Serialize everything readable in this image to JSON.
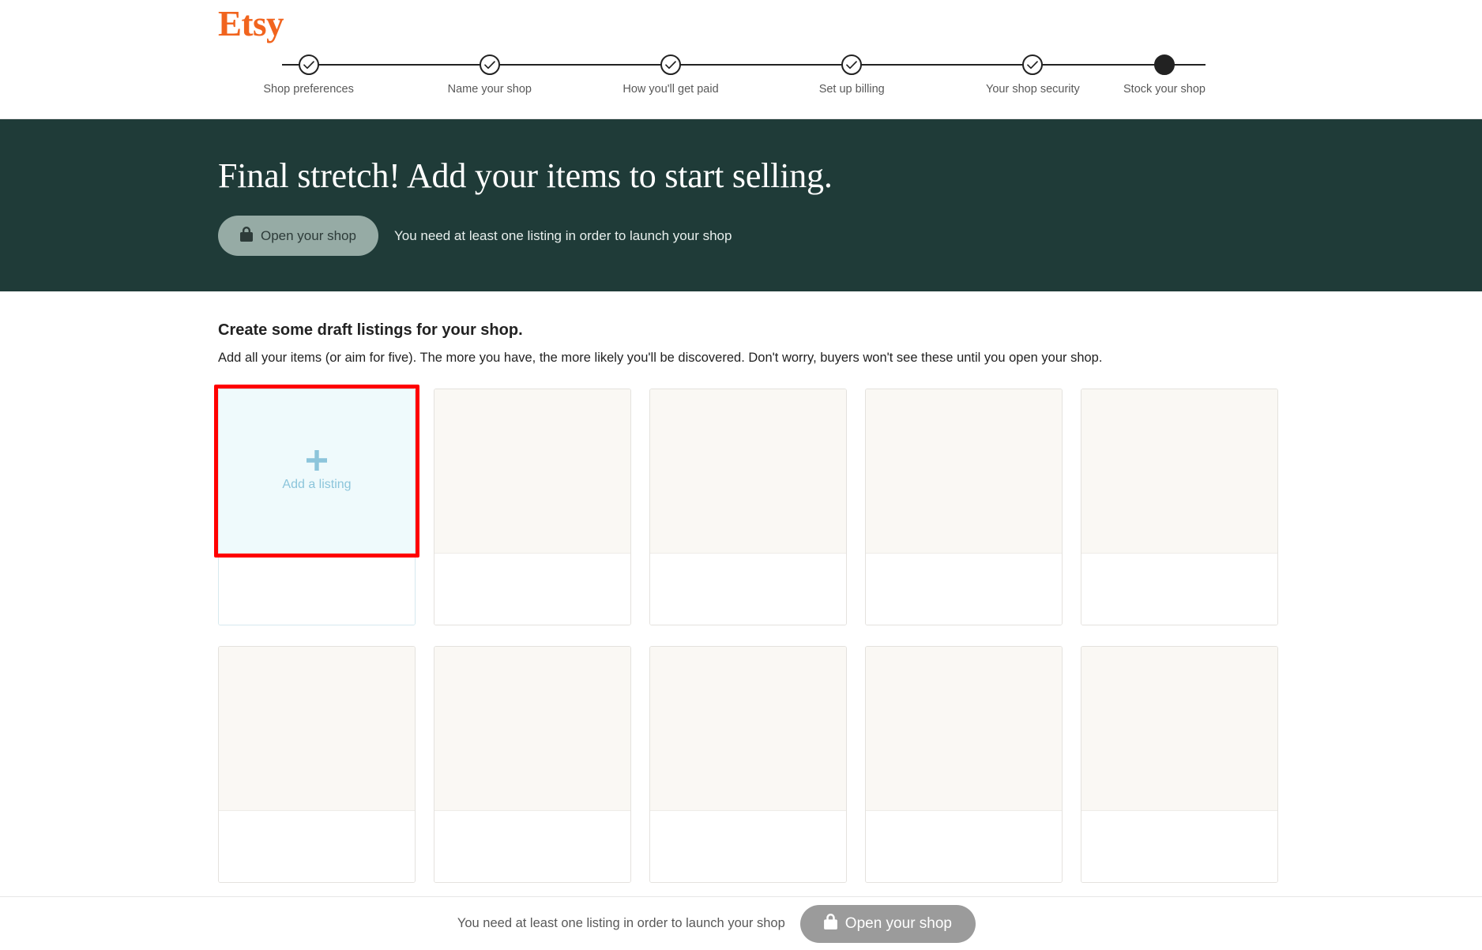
{
  "brand": {
    "logo_text": "Etsy",
    "logo_color": "#F1641E",
    "hero_bg_color": "#1F3B38",
    "highlight_color": "#FF0000",
    "add_tile_color": "#8CC5DB"
  },
  "stepper": {
    "steps": [
      {
        "label": "Shop preferences",
        "state": "complete",
        "icon": "check-icon"
      },
      {
        "label": "Name your shop",
        "state": "complete",
        "icon": "check-icon"
      },
      {
        "label": "How you'll get paid",
        "state": "complete",
        "icon": "check-icon"
      },
      {
        "label": "Set up billing",
        "state": "complete",
        "icon": "check-icon"
      },
      {
        "label": "Your shop security",
        "state": "complete",
        "icon": "check-icon"
      },
      {
        "label": "Stock your shop",
        "state": "current",
        "icon": "filled-dot-icon"
      }
    ]
  },
  "hero": {
    "title": "Final stretch! Add your items to start selling.",
    "button_label": "Open your shop",
    "button_icon": "lock-icon",
    "note": "You need at least one listing in order to launch your shop"
  },
  "main": {
    "section_title": "Create some draft listings for your shop.",
    "section_subtitle": "Add all your items (or aim for five). The more you have, the more likely you'll be discovered. Don't worry, buyers won't see these until you open your shop.",
    "add_listing": {
      "label": "Add a listing",
      "icon": "plus-icon",
      "highlighted": true
    },
    "placeholder_cards_row1": 4,
    "placeholder_cards_row2": 5
  },
  "footer": {
    "note": "You need at least one listing in order to launch your shop",
    "button_label": "Open your shop",
    "button_icon": "lock-icon"
  }
}
